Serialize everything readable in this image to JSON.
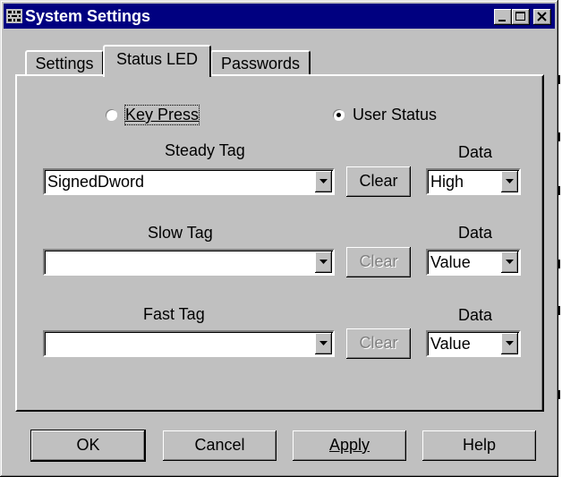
{
  "window": {
    "title": "System Settings",
    "icon": "app-grid-icon"
  },
  "tabs": [
    {
      "label": "Settings",
      "active": false
    },
    {
      "label": "Status LED",
      "active": true
    },
    {
      "label": "Passwords",
      "active": false
    }
  ],
  "mode": {
    "key_press": {
      "label": "Key Press",
      "selected": false
    },
    "user_status": {
      "label": "User Status",
      "selected": true
    }
  },
  "rows": [
    {
      "tag_label": "Steady Tag",
      "tag_value": "SignedDword",
      "clear_label": "Clear",
      "clear_enabled": true,
      "data_label": "Data",
      "data_value": "High"
    },
    {
      "tag_label": "Slow Tag",
      "tag_value": "",
      "clear_label": "Clear",
      "clear_enabled": false,
      "data_label": "Data",
      "data_value": "Value"
    },
    {
      "tag_label": "Fast Tag",
      "tag_value": "",
      "clear_label": "Clear",
      "clear_enabled": false,
      "data_label": "Data",
      "data_value": "Value"
    }
  ],
  "buttons": {
    "ok": "OK",
    "cancel": "Cancel",
    "apply": "Apply",
    "help": "Help"
  }
}
